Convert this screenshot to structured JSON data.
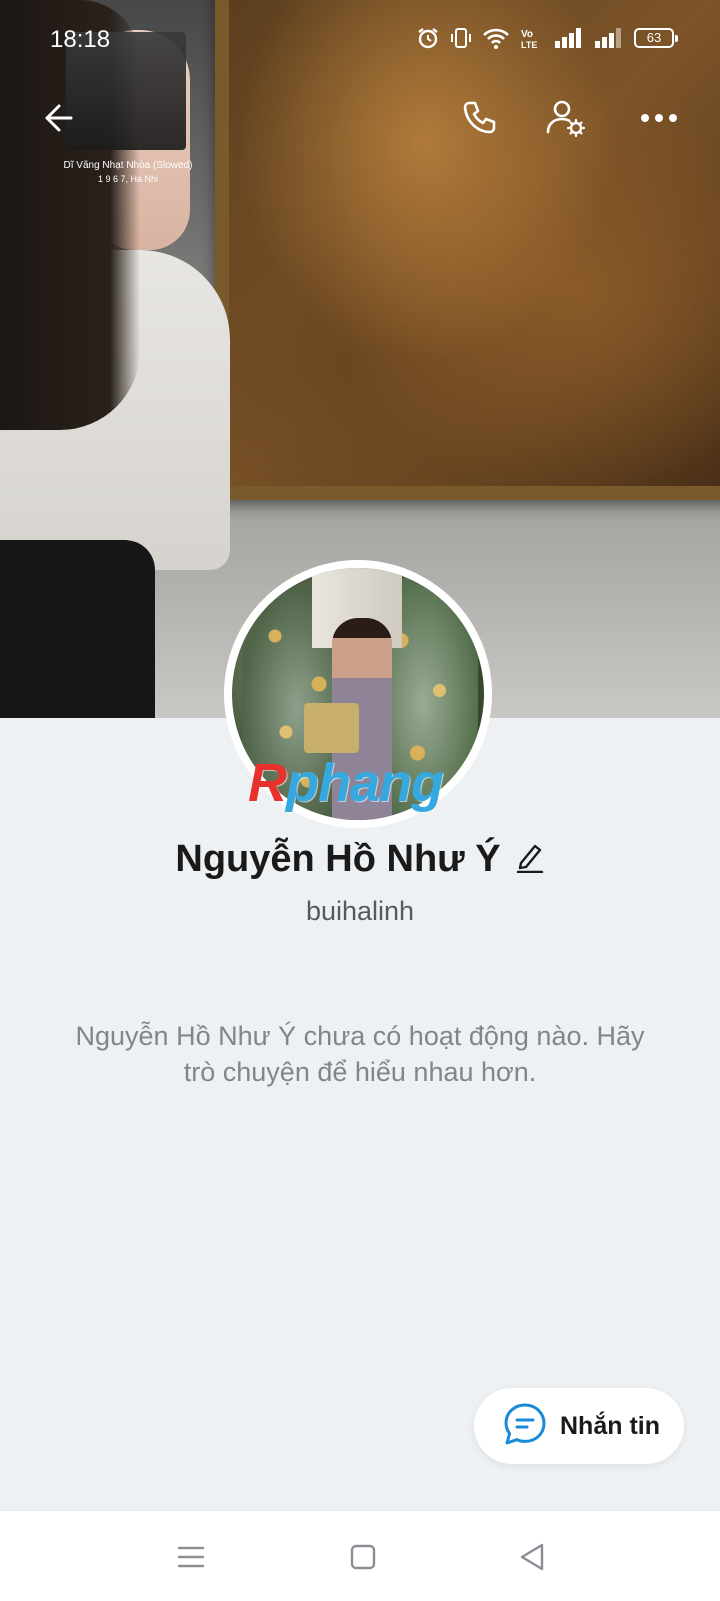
{
  "status_bar": {
    "time": "18:18",
    "battery": "63"
  },
  "music_widget": {
    "title": "Dĩ Vãng Nhạt Nhòa (Slowed)",
    "subtitle": "1 9 6 7, Hà Nhi"
  },
  "profile": {
    "name": "Nguyễn Hồ Như Ý",
    "username": "buihalinh",
    "activity_message": "Nguyễn Hồ Như Ý chưa có hoạt động nào. Hãy trò chuyện để hiểu nhau hơn."
  },
  "watermark": {
    "first_letter": "R",
    "rest": "phang"
  },
  "actions": {
    "message_label": "Nhắn tin"
  },
  "icons": {
    "back": "arrow-left-icon",
    "call": "phone-icon",
    "settings": "user-settings-icon",
    "more": "more-dots-icon",
    "edit": "pencil-icon",
    "message": "chat-bubble-icon",
    "nav_menu": "menu-lines-icon",
    "nav_home": "square-home-icon",
    "nav_back": "triangle-back-icon"
  },
  "colors": {
    "background": "#eef1f4",
    "accent": "#1a8ad8",
    "text_primary": "#1a1a1a",
    "text_secondary": "#80868d"
  }
}
